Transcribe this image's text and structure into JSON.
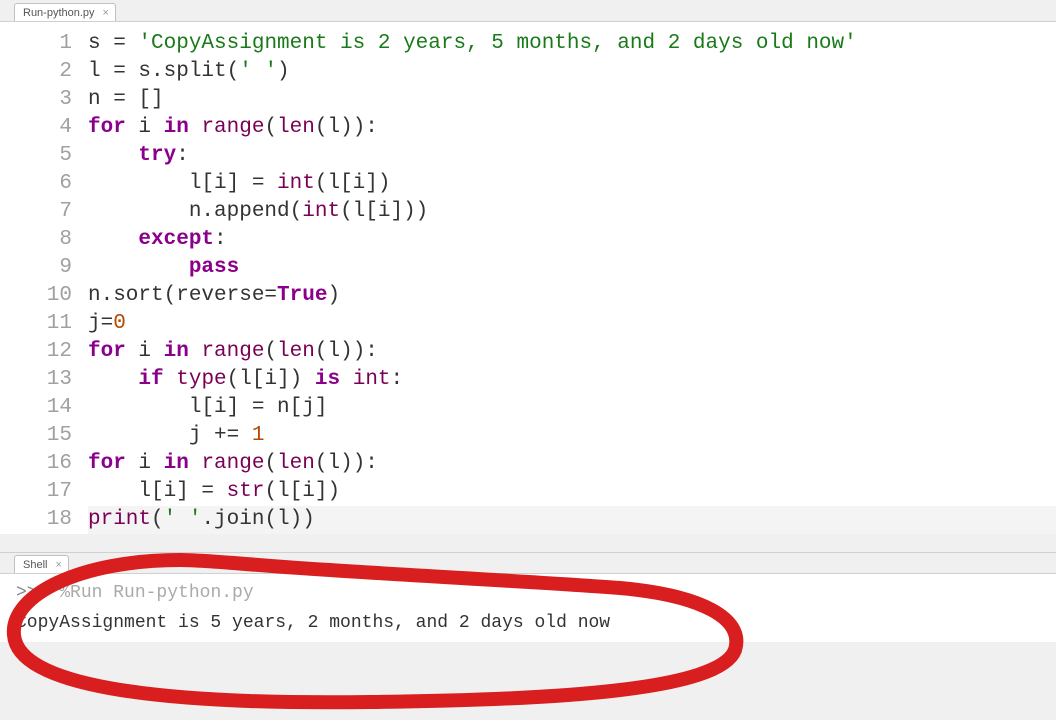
{
  "editor": {
    "tab_title": "Run-python.py",
    "lines": [
      {
        "num": "1",
        "html": "s = <span class='c-str'>'CopyAssignment is 2 years, 5 months, and 2 days old now'</span>"
      },
      {
        "num": "2",
        "html": "l = s.split(<span class='c-str'>' '</span>)"
      },
      {
        "num": "3",
        "html": "n = []"
      },
      {
        "num": "4",
        "html": "<span class='c-kw'>for</span> i <span class='c-kw'>in</span> <span class='c-fn'>range</span>(<span class='c-fn'>len</span>(l)):"
      },
      {
        "num": "5",
        "html": "    <span class='c-kw'>try</span>:"
      },
      {
        "num": "6",
        "html": "        l[i] = <span class='c-fn'>int</span>(l[i])"
      },
      {
        "num": "7",
        "html": "        n.append(<span class='c-fn'>int</span>(l[i]))"
      },
      {
        "num": "8",
        "html": "    <span class='c-kw'>except</span>:"
      },
      {
        "num": "9",
        "html": "        <span class='c-kw'>pass</span>"
      },
      {
        "num": "10",
        "html": "n.sort(reverse=<span class='c-kw'>True</span>)"
      },
      {
        "num": "11",
        "html": "j=<span class='c-num'>0</span>"
      },
      {
        "num": "12",
        "html": "<span class='c-kw'>for</span> i <span class='c-kw'>in</span> <span class='c-fn'>range</span>(<span class='c-fn'>len</span>(l)):"
      },
      {
        "num": "13",
        "html": "    <span class='c-kw'>if</span> <span class='c-fn'>type</span>(l[i]) <span class='c-kw'>is</span> <span class='c-fn'>int</span>:"
      },
      {
        "num": "14",
        "html": "        l[i] = n[j]"
      },
      {
        "num": "15",
        "html": "        j += <span class='c-num'>1</span>"
      },
      {
        "num": "16",
        "html": "<span class='c-kw'>for</span> i <span class='c-kw'>in</span> <span class='c-fn'>range</span>(<span class='c-fn'>len</span>(l)):"
      },
      {
        "num": "17",
        "html": "    l[i] = <span class='c-fn'>str</span>(l[i])"
      },
      {
        "num": "18",
        "html": "<span class='c-fn'>print</span>(<span class='c-str'>' '</span>.join(l))",
        "hl": true
      }
    ]
  },
  "shell": {
    "tab_title": "Shell",
    "prompt": ">>> ",
    "command": "%Run Run-python.py",
    "output": "CopyAssignment is 5 years, 2 months, and 2 days old now"
  }
}
